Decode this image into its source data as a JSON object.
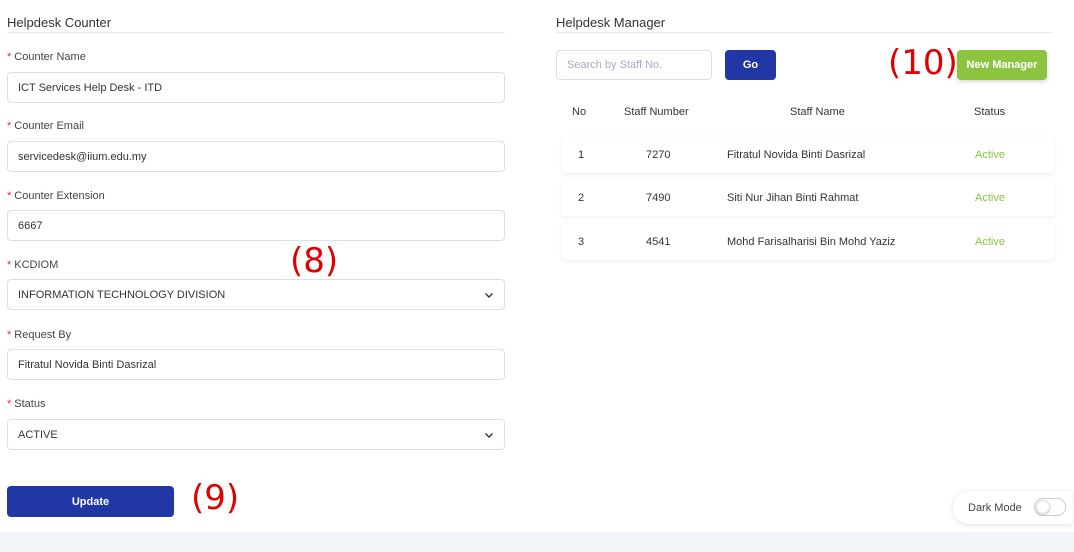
{
  "counter": {
    "section_title": "Helpdesk Counter",
    "fields": [
      {
        "label": "Counter Name",
        "value": "ICT Services Help Desk - ITD"
      },
      {
        "label": "Counter Email",
        "value": "servicedesk@iium.edu.my"
      },
      {
        "label": "Counter Extension",
        "value": "6667"
      },
      {
        "label": "KCDIOM",
        "value": "INFORMATION TECHNOLOGY DIVISION"
      },
      {
        "label": "Request By",
        "value": "Fitratul Novida Binti Dasrizal"
      },
      {
        "label": "Status",
        "value": "ACTIVE"
      }
    ],
    "required_mark": "*",
    "update_label": "Update"
  },
  "manager": {
    "section_title": "Helpdesk Manager",
    "search_placeholder": "Search by Staff No.",
    "go_label": "Go",
    "new_label": "New Manager",
    "columns": {
      "no": "No",
      "staff_number": "Staff Number",
      "staff_name": "Staff Name",
      "status": "Status"
    },
    "rows": [
      {
        "no": "1",
        "staff_number": "7270",
        "staff_name": "Fitratul Novida Binti Dasrizal",
        "status": "Active"
      },
      {
        "no": "2",
        "staff_number": "7490",
        "staff_name": "Siti Nur Jihan Binti Rahmat",
        "status": "Active"
      },
      {
        "no": "3",
        "staff_number": "4541",
        "staff_name": "Mohd Farisalharisi Bin Mohd Yaziz",
        "status": "Active"
      }
    ]
  },
  "annotations": {
    "a8": "(8)",
    "a9": "(9)",
    "a10": "(10)"
  },
  "dark_mode": {
    "label": "Dark Mode",
    "enabled": false
  },
  "colors": {
    "primary": "#2137a5",
    "success": "#8cc43f",
    "required": "#e03131",
    "annotation": "#e00000"
  },
  "icons": {
    "dropdown": "chevron-down-icon"
  }
}
